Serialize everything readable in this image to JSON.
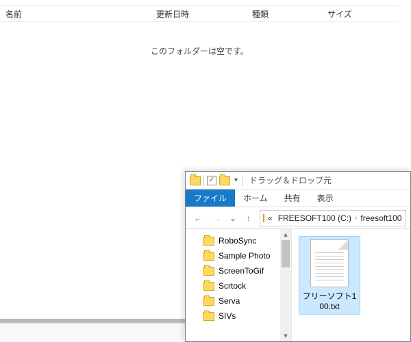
{
  "rear": {
    "columns": {
      "name": "名前",
      "date": "更新日時",
      "type": "種類",
      "size": "サイズ"
    },
    "empty": "このフォルダーは空です。"
  },
  "front": {
    "qat_title": "ドラッグ＆ドロップ元",
    "tabs": {
      "file": "ファイル",
      "home": "ホーム",
      "share": "共有",
      "view": "表示"
    },
    "breadcrumb": {
      "prefix": "«",
      "seg1": "FREESOFT100 (C:)",
      "seg2": "freesoft100"
    },
    "tree": [
      "RoboSync",
      "Sample Photo",
      "ScreenToGif",
      "Scrtock",
      "Serva",
      "SIVs"
    ],
    "file": {
      "name": "フリーソフト100.txt"
    }
  }
}
